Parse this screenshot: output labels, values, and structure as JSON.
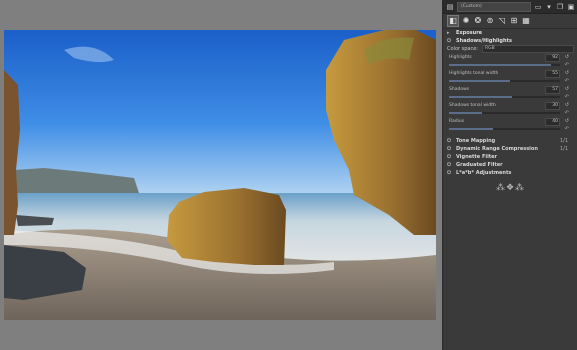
{
  "panel": {
    "profile_label": "(Custom)",
    "top_icons": [
      "profile-icon",
      "open-icon",
      "save-icon",
      "copy-icon",
      "paste-icon"
    ],
    "tabs": [
      "exposure-tab-icon",
      "detail-tab-icon",
      "color-tab-icon",
      "advanced-tab-icon",
      "transform-tab-icon",
      "raw-tab-icon",
      "metadata-tab-icon"
    ],
    "exposure_label": "Exposure",
    "shadows_highlights_label": "Shadows/Highlights",
    "color_space_label": "Color space:",
    "color_space_value": "RGB",
    "sliders": [
      {
        "label": "Highlights",
        "value": "92",
        "fraction": 0.92
      },
      {
        "label": "Highlights tonal width",
        "value": "55",
        "fraction": 0.55
      },
      {
        "label": "Shadows",
        "value": "57",
        "fraction": 0.57
      },
      {
        "label": "Shadows tonal width",
        "value": "30",
        "fraction": 0.3
      },
      {
        "label": "Radius",
        "value": "40",
        "fraction": 0.4
      }
    ],
    "tools": [
      {
        "label": "Tone Mapping",
        "count": "1/1"
      },
      {
        "label": "Dynamic Range Compression",
        "count": "1/1"
      },
      {
        "label": "Vignette Filter",
        "count": ""
      },
      {
        "label": "Graduated Filter",
        "count": ""
      },
      {
        "label": "L*a*b* Adjustments",
        "count": ""
      }
    ]
  }
}
